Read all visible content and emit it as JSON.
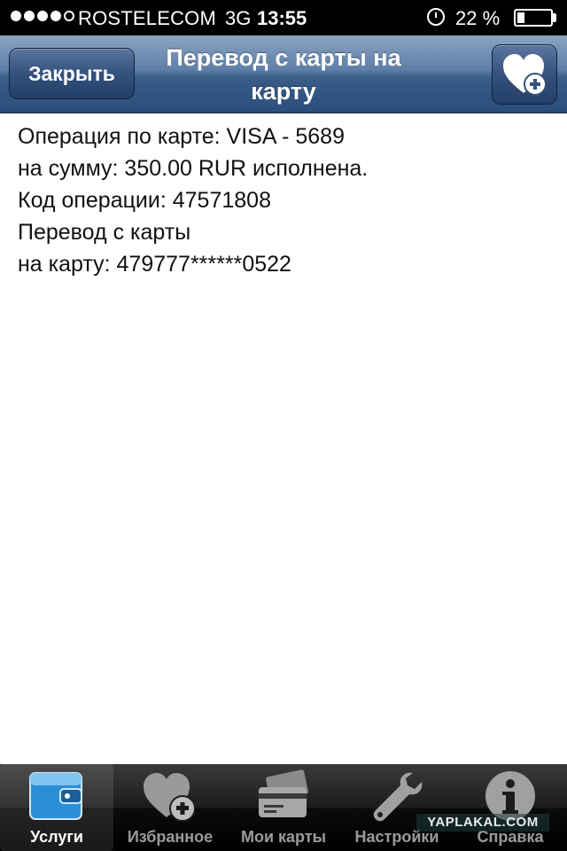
{
  "status_bar": {
    "signal_bars_filled": 4,
    "signal_bars_total": 5,
    "carrier": "ROSTELECOM",
    "network": "3G",
    "time": "13:55",
    "battery_percent_text": "22 %",
    "battery_level": 0.22,
    "alarm_icon": "alarm-clock-icon"
  },
  "nav": {
    "close_label": "Закрыть",
    "title": "Перевод с карты на карту",
    "favorite_icon": "heart-plus-icon"
  },
  "content": {
    "lines": [
      "Операция по карте: VISA - 5689",
      "на сумму: 350.00 RUR исполнена.",
      "Код операции: 47571808",
      "Перевод с карты",
      "на карту: 479777******0522"
    ]
  },
  "tabs": [
    {
      "label": "Услуги",
      "icon": "wallet-icon",
      "active": true
    },
    {
      "label": "Избранное",
      "icon": "heart-plus-icon",
      "active": false
    },
    {
      "label": "Мои карты",
      "icon": "credit-cards-icon",
      "active": false
    },
    {
      "label": "Настройки",
      "icon": "wrench-icon",
      "active": false
    },
    {
      "label": "Справка",
      "icon": "info-icon",
      "active": false
    }
  ],
  "watermark": "YAPLAKAL.COM",
  "colors": {
    "nav_dark": "#2c4e7c",
    "nav_light": "#8aa4c3",
    "tabbar": "#000000",
    "wallet_blue": "#2a8fd6"
  }
}
